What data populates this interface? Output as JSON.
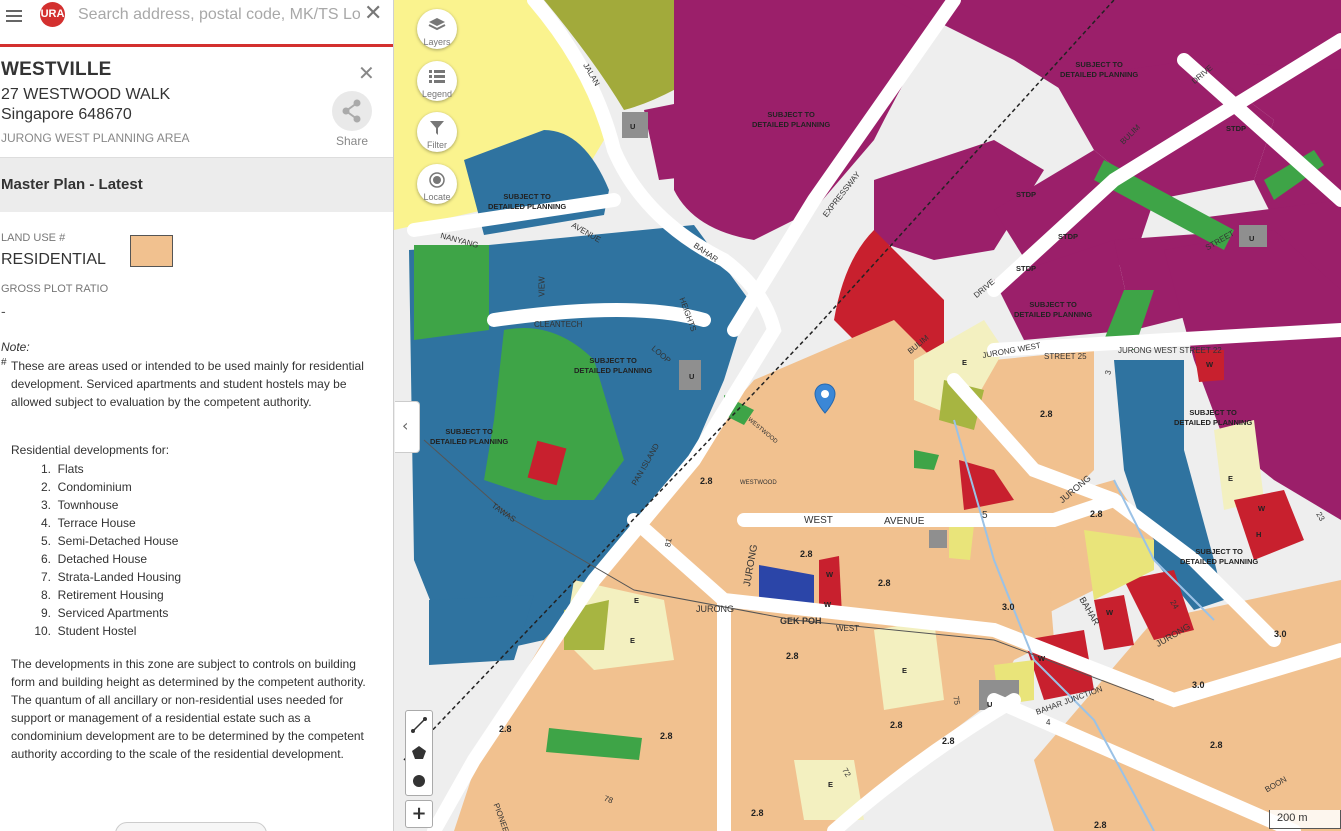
{
  "search": {
    "placeholder": "Search address, postal code, MK/TS Lo",
    "logo_text": "URA",
    "menu_icon": "hamburger-icon",
    "clear_icon": "close-icon"
  },
  "place": {
    "name": "WESTVILLE",
    "address": "27 WESTWOOD WALK",
    "postal": "Singapore 648670",
    "planning_area": "JURONG WEST PLANNING AREA",
    "share_label": "Share"
  },
  "master_plan": {
    "title": "Master Plan - Latest",
    "land_use_label": "LAND USE #",
    "land_use_value": "RESIDENTIAL",
    "land_use_color": "#f1c18f",
    "gpr_label": "GROSS PLOT RATIO",
    "gpr_value": "-",
    "note_label": "Note:",
    "note_mark": "#",
    "note_text": "These are areas used or intended to be used mainly for residential development. Serviced apartments and student hostels may be allowed subject to evaluation by the competent authority.",
    "developments_title": "Residential developments for:",
    "developments": [
      {
        "num": "1.",
        "label": "Flats"
      },
      {
        "num": "2.",
        "label": "Condominium"
      },
      {
        "num": "3.",
        "label": "Townhouse"
      },
      {
        "num": "4.",
        "label": "Terrace House"
      },
      {
        "num": "5.",
        "label": "Semi-Detached House"
      },
      {
        "num": "6.",
        "label": "Detached House"
      },
      {
        "num": "7.",
        "label": "Strata-Landed Housing"
      },
      {
        "num": "8.",
        "label": "Retirement Housing"
      },
      {
        "num": "9.",
        "label": "Serviced Apartments"
      },
      {
        "num": "10.",
        "label": "Student Hostel"
      }
    ],
    "controls_text": "The developments in this zone are subject to controls on building form and building height as determined by the competent authority. The quantum of all ancillary or non-residential uses needed for support or management of a residential estate such as a condominium development are to be determined by the competent authority according to the scale of the residential development."
  },
  "map": {
    "buttons": [
      {
        "label": "Layers",
        "icon": "layers-icon"
      },
      {
        "label": "Legend",
        "icon": "legend-icon"
      },
      {
        "label": "Filter",
        "icon": "filter-icon"
      },
      {
        "label": "Locate",
        "icon": "locate-icon"
      }
    ],
    "scale_label": "200 m",
    "zone_labels": {
      "sdp": "SUBJECT TO\nDETAILED PLANNING",
      "stdp": "STDP",
      "u": "U",
      "e": "E",
      "w": "W",
      "h": "H"
    },
    "plot_ratios": [
      "2.8",
      "3.0"
    ],
    "roads": [
      "JALAN",
      "BAHAR",
      "EXPRESSWAY",
      "PAN ISLAND",
      "NANYANG",
      "AVENUE",
      "CLEANTECH",
      "VIEW",
      "HEIGHTS",
      "LOOP",
      "TAWAS",
      "BULIM",
      "DRIVE",
      "STREET",
      "JURONG WEST",
      "STREET 25",
      "JURONG WEST STREET 22",
      "WEST",
      "5",
      "JURONG",
      "GEK POH",
      "BAHAR JUNCTION",
      "BOON",
      "PIONEER",
      "WESTWOOD",
      "3",
      "81",
      "72",
      "4",
      "24",
      "23",
      "75",
      "78"
    ],
    "colors": {
      "residential": "#f1c18f",
      "business": "#9b1f6a",
      "sdp_blue": "#2f73a0",
      "park": "#3ea447",
      "education": "#f3f0c0",
      "utility": "#8f8f8f",
      "commercial": "#c8202e",
      "civic": "#2b45a8",
      "reserve": "#e9e47a",
      "olive": "#a7b541"
    }
  }
}
